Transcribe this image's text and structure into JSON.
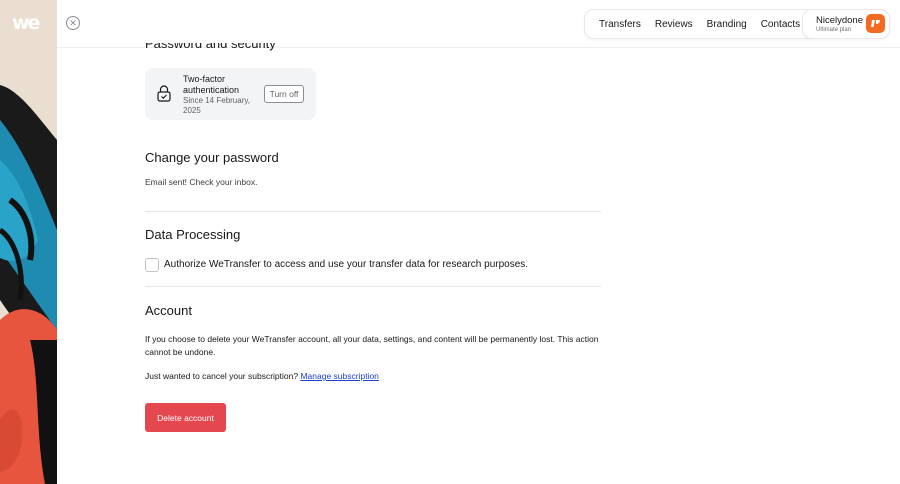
{
  "brand": {
    "logo_text": "we"
  },
  "nav": {
    "items": [
      {
        "label": "Transfers"
      },
      {
        "label": "Reviews"
      },
      {
        "label": "Branding"
      },
      {
        "label": "Contacts"
      }
    ]
  },
  "account": {
    "name": "Nicelydone",
    "plan": "Ultimate plan",
    "accent_color": "#f26b20"
  },
  "security": {
    "heading": "Password and security",
    "two_factor": {
      "title": "Two-factor authentication",
      "since": "Since 14 February, 2025",
      "turn_off_label": "Turn off"
    }
  },
  "password": {
    "heading": "Change your password",
    "status": "Email sent! Check your inbox."
  },
  "data_processing": {
    "heading": "Data Processing",
    "checkbox_label": "Authorize WeTransfer to access and use your transfer data for research purposes.",
    "checked": false
  },
  "account_section": {
    "heading": "Account",
    "warning": "If you choose to delete your WeTransfer account, all your data, settings, and content will be permanently lost. This action cannot be undone.",
    "cancel_prompt": "Just wanted to cancel your subscription?",
    "manage_link": "Manage subscription",
    "delete_label": "Delete account",
    "delete_color": "#e5474f"
  }
}
